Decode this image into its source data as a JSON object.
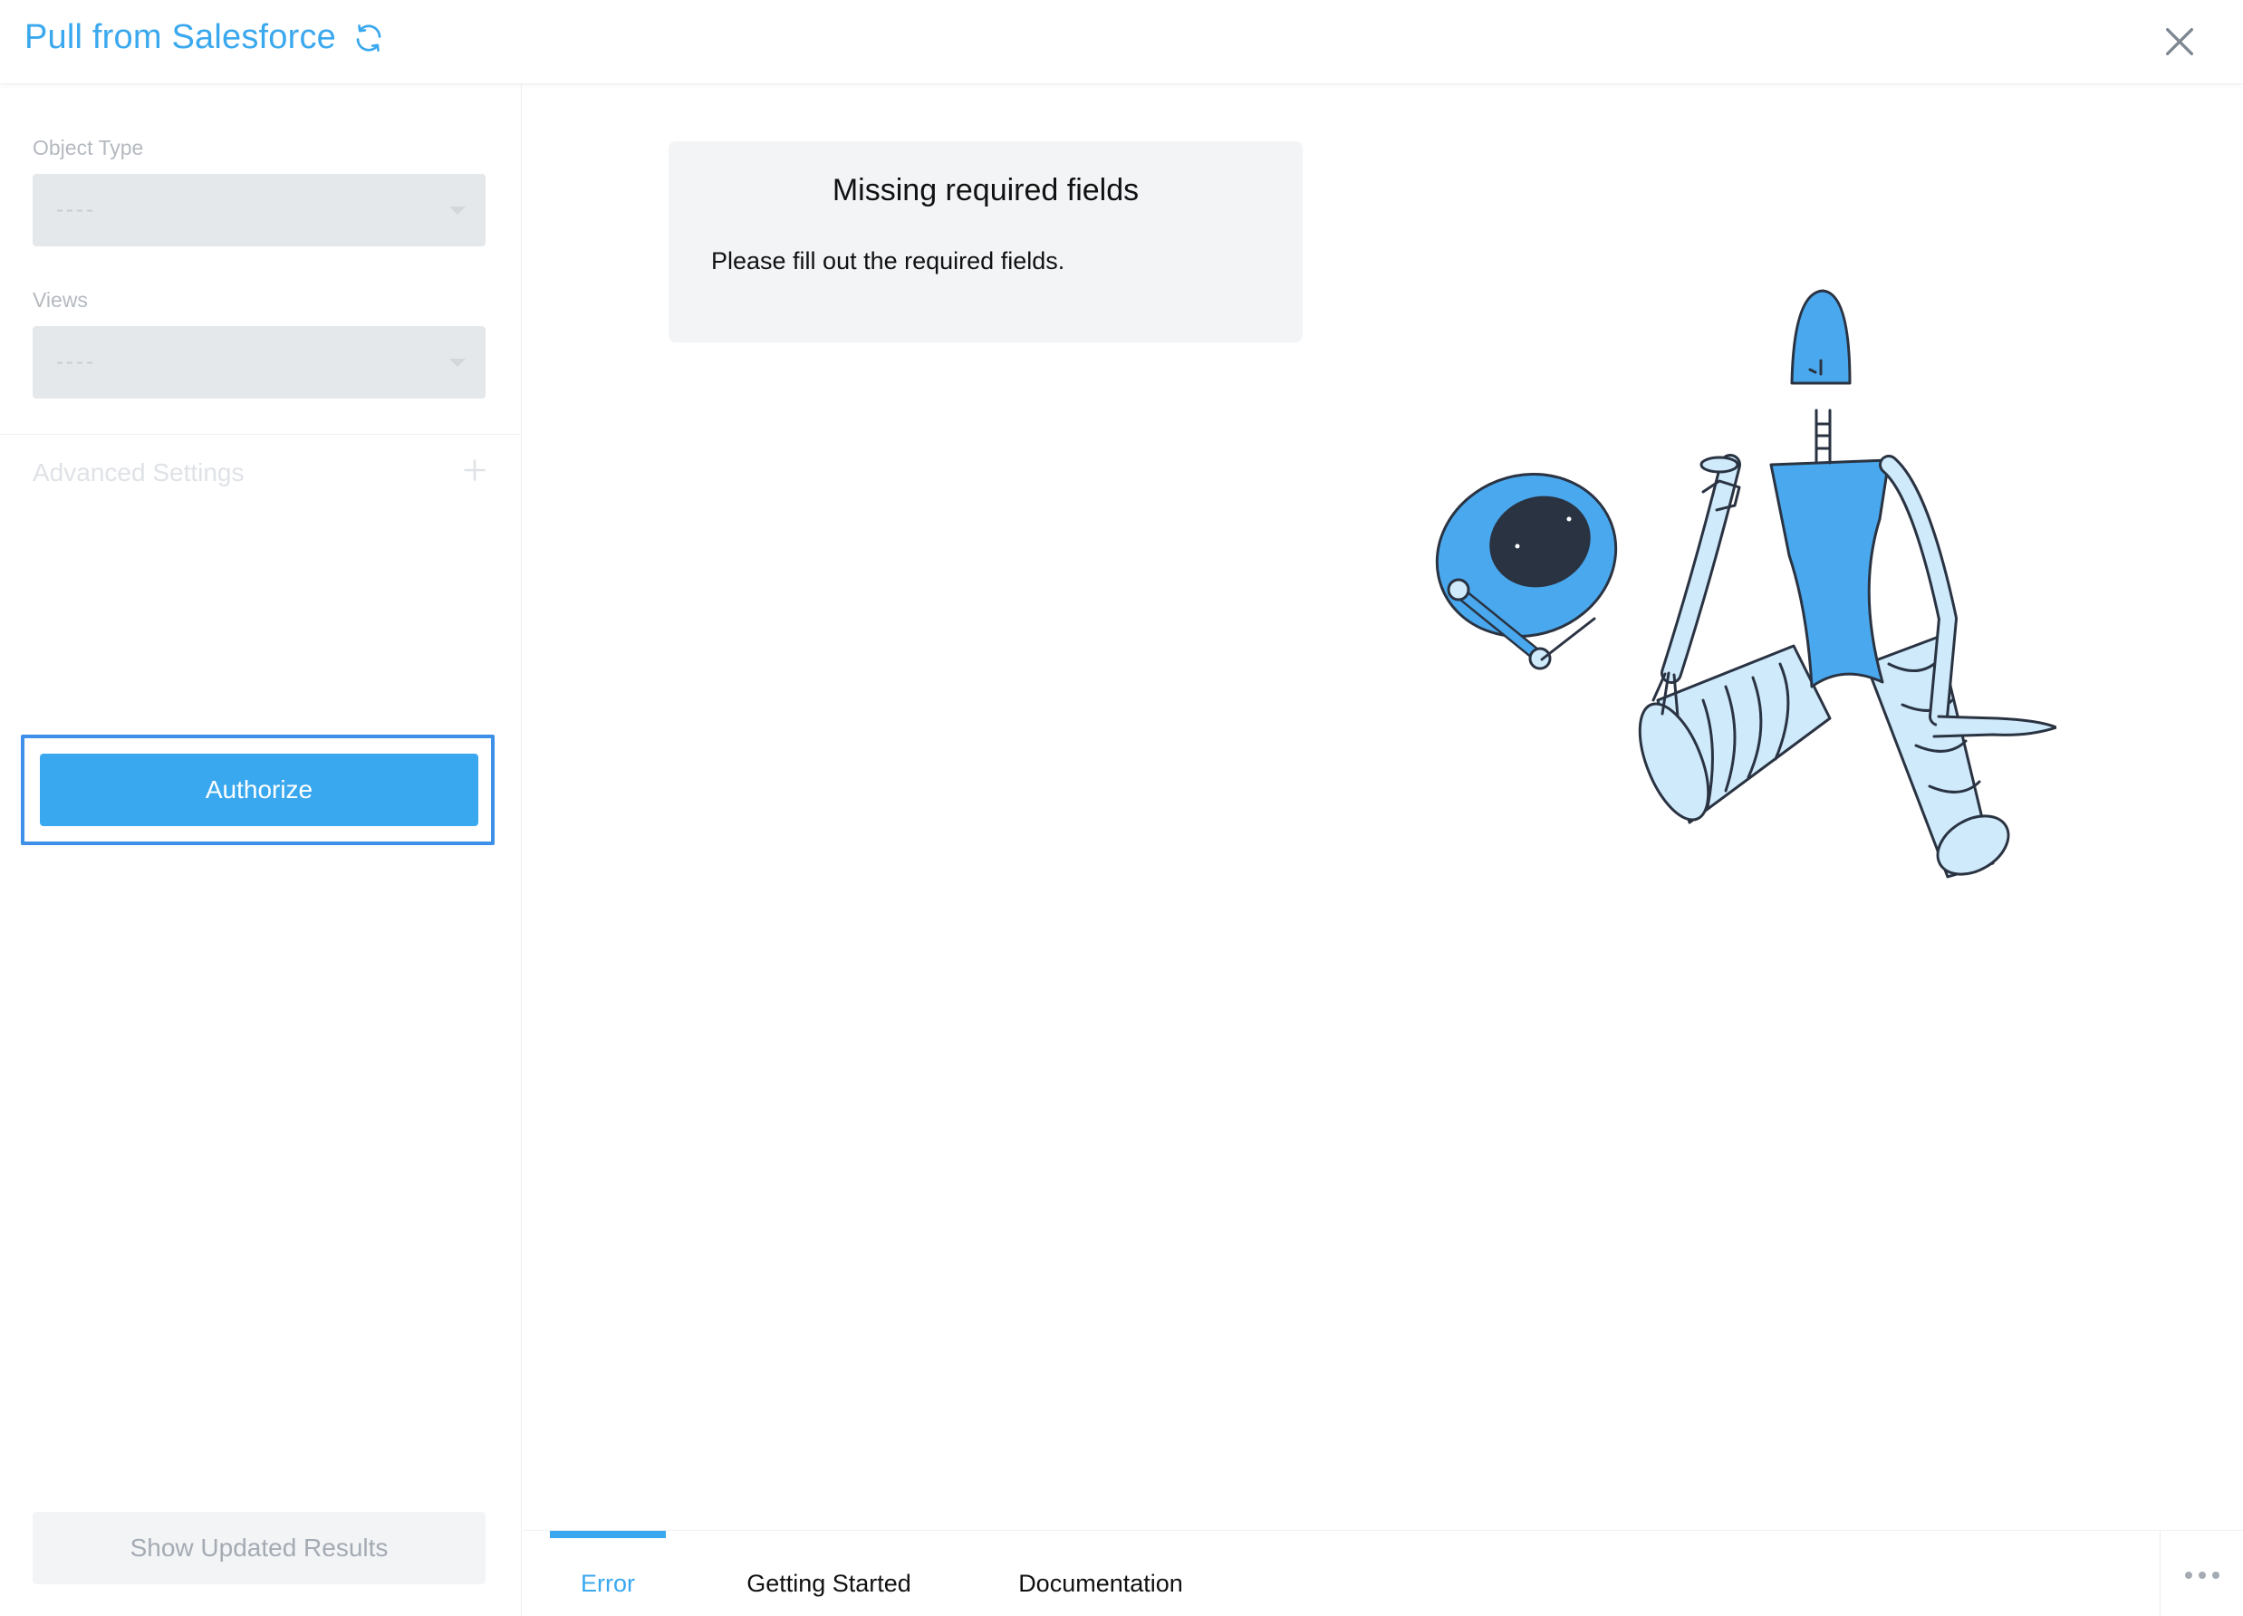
{
  "header": {
    "title": "Pull from Salesforce",
    "refresh_icon": "refresh-icon",
    "close_icon": "close-icon"
  },
  "sidebar": {
    "object_type": {
      "label": "Object Type",
      "value": "----"
    },
    "views": {
      "label": "Views",
      "value": "----"
    },
    "advanced_settings": {
      "label": "Advanced Settings",
      "icon": "plus-icon"
    },
    "authorize_label": "Authorize",
    "show_updated_label": "Show Updated Results"
  },
  "main": {
    "error": {
      "title": "Missing required fields",
      "message": "Please fill out the required fields."
    }
  },
  "tabs": [
    {
      "label": "Error",
      "active": true
    },
    {
      "label": "Getting Started",
      "active": false
    },
    {
      "label": "Documentation",
      "active": false
    }
  ],
  "colors": {
    "accent": "#3aa8ee",
    "focus_outline": "#3d8fe8",
    "robot_blue": "#4aa9ee",
    "robot_light": "#cfeafb",
    "robot_dark": "#2a3342"
  }
}
